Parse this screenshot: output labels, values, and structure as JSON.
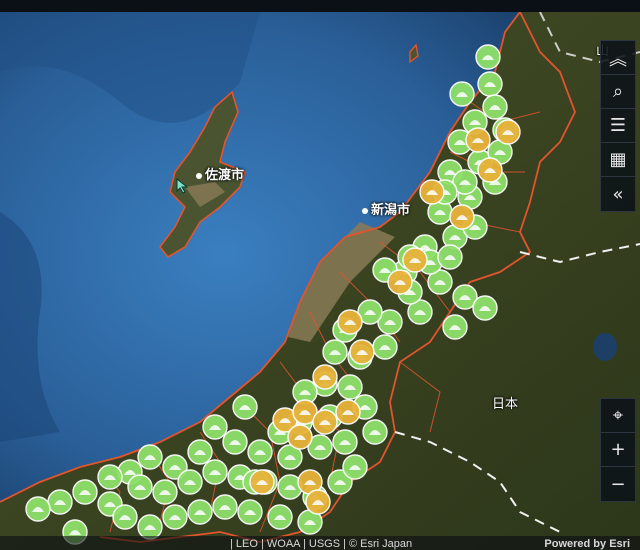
{
  "map": {
    "labels": {
      "sado": "佐渡市",
      "niigata": "新潟市",
      "japan": "日本",
      "yamagata_partial": "山"
    },
    "attribution_left": "| LEO | WOAA | USGS | © Esri Japan",
    "attribution_right": "Powered by Esri",
    "colors": {
      "sea": "#2f6aa8",
      "land": "#3d4a22",
      "boundary": "#e2542e",
      "marker_green": "#8ee06a",
      "marker_orange": "#e8b33a"
    }
  },
  "toolbar": {
    "top": [
      {
        "name": "collapse-up-icon",
        "glyph": "︽"
      },
      {
        "name": "search-icon",
        "glyph": "⌕"
      },
      {
        "name": "layer-list-icon",
        "glyph": "☰"
      },
      {
        "name": "qr-code-icon",
        "glyph": "▦"
      },
      {
        "name": "collapse-left-icon",
        "glyph": "«"
      }
    ],
    "bottom": [
      {
        "name": "locate-icon",
        "glyph": "⌖"
      },
      {
        "name": "zoom-in-icon",
        "glyph": "+"
      },
      {
        "name": "zoom-out-icon",
        "glyph": "−"
      }
    ]
  }
}
